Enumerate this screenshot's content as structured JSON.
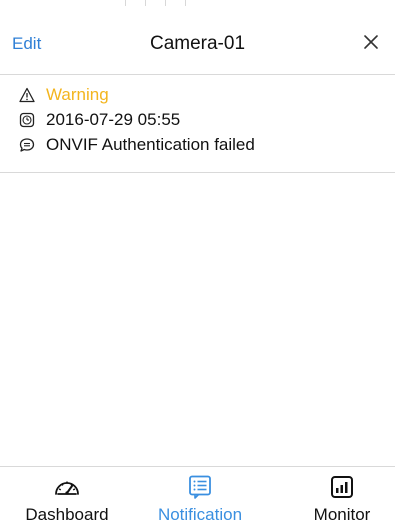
{
  "header": {
    "edit_label": "Edit",
    "title": "Camera-01",
    "close_icon": "close-icon"
  },
  "notification": {
    "level": "Warning",
    "timestamp": "2016-07-29 05:55",
    "message": "ONVIF Authentication failed",
    "icons": {
      "level": "warning-icon",
      "timestamp": "clock-icon",
      "message": "message-icon"
    }
  },
  "tabs": [
    {
      "label": "Dashboard",
      "icon": "speedometer-icon",
      "active": false
    },
    {
      "label": "Notification",
      "icon": "list-icon",
      "active": true
    },
    {
      "label": "Monitor",
      "icon": "chart-icon",
      "active": false
    }
  ],
  "colors": {
    "accent": "#3a8fe0",
    "warning": "#f3b51e",
    "divider": "#d9d9d9"
  }
}
